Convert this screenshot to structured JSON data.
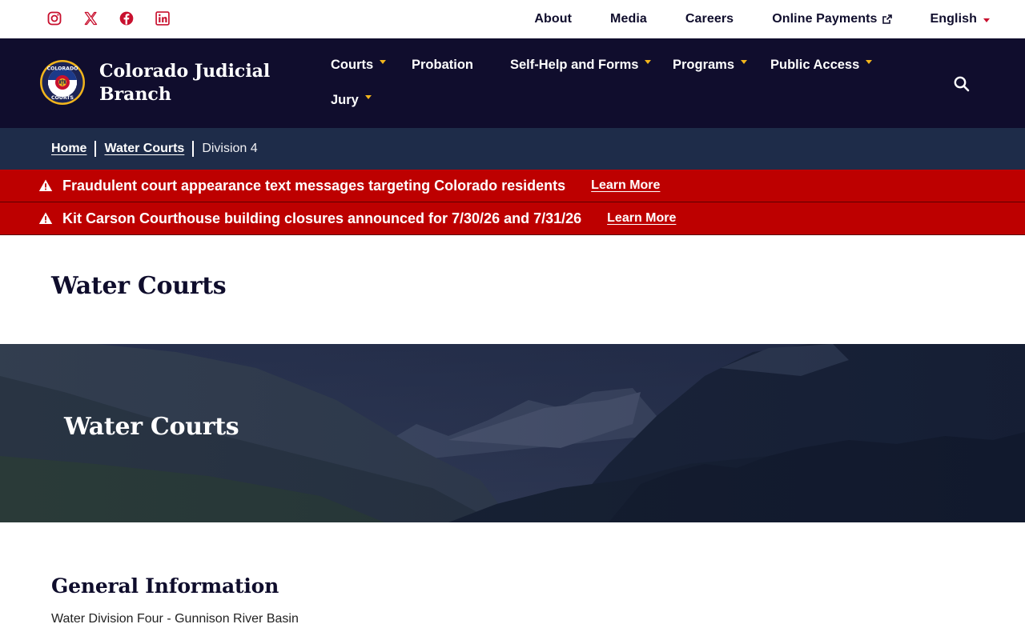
{
  "social": {
    "icons": [
      "instagram-icon",
      "x-icon",
      "facebook-icon",
      "linkedin-icon"
    ],
    "color": "#c8102e"
  },
  "utility_nav": {
    "about": "About",
    "media": "Media",
    "careers": "Careers",
    "online_payments": "Online Payments",
    "language": "English"
  },
  "header": {
    "site_name": "Colorado Judicial Branch",
    "logo_text_top": "COLORADO",
    "logo_text_bottom": "COURTS",
    "background": "#100d2d",
    "accent": "#f2b51c"
  },
  "main_nav": {
    "courts": "Courts",
    "probation": "Probation",
    "self_help": "Self-Help and Forms",
    "programs": "Programs",
    "public_access": "Public Access",
    "jury": "Jury"
  },
  "breadcrumb": {
    "home": "Home",
    "water_courts": "Water Courts",
    "current": "Division 4"
  },
  "alerts": [
    {
      "text": "Fraudulent court appearance text messages targeting Colorado residents",
      "link": "Learn More"
    },
    {
      "text": "Kit Carson Courthouse building closures announced for 7/30/26 and 7/31/26",
      "link": "Learn More"
    }
  ],
  "alert_color": "#bd0000",
  "page": {
    "title": "Water Courts",
    "hero_title": "Water Courts",
    "section_heading": "General Information",
    "section_text": "Water Division Four - Gunnison River Basin"
  }
}
